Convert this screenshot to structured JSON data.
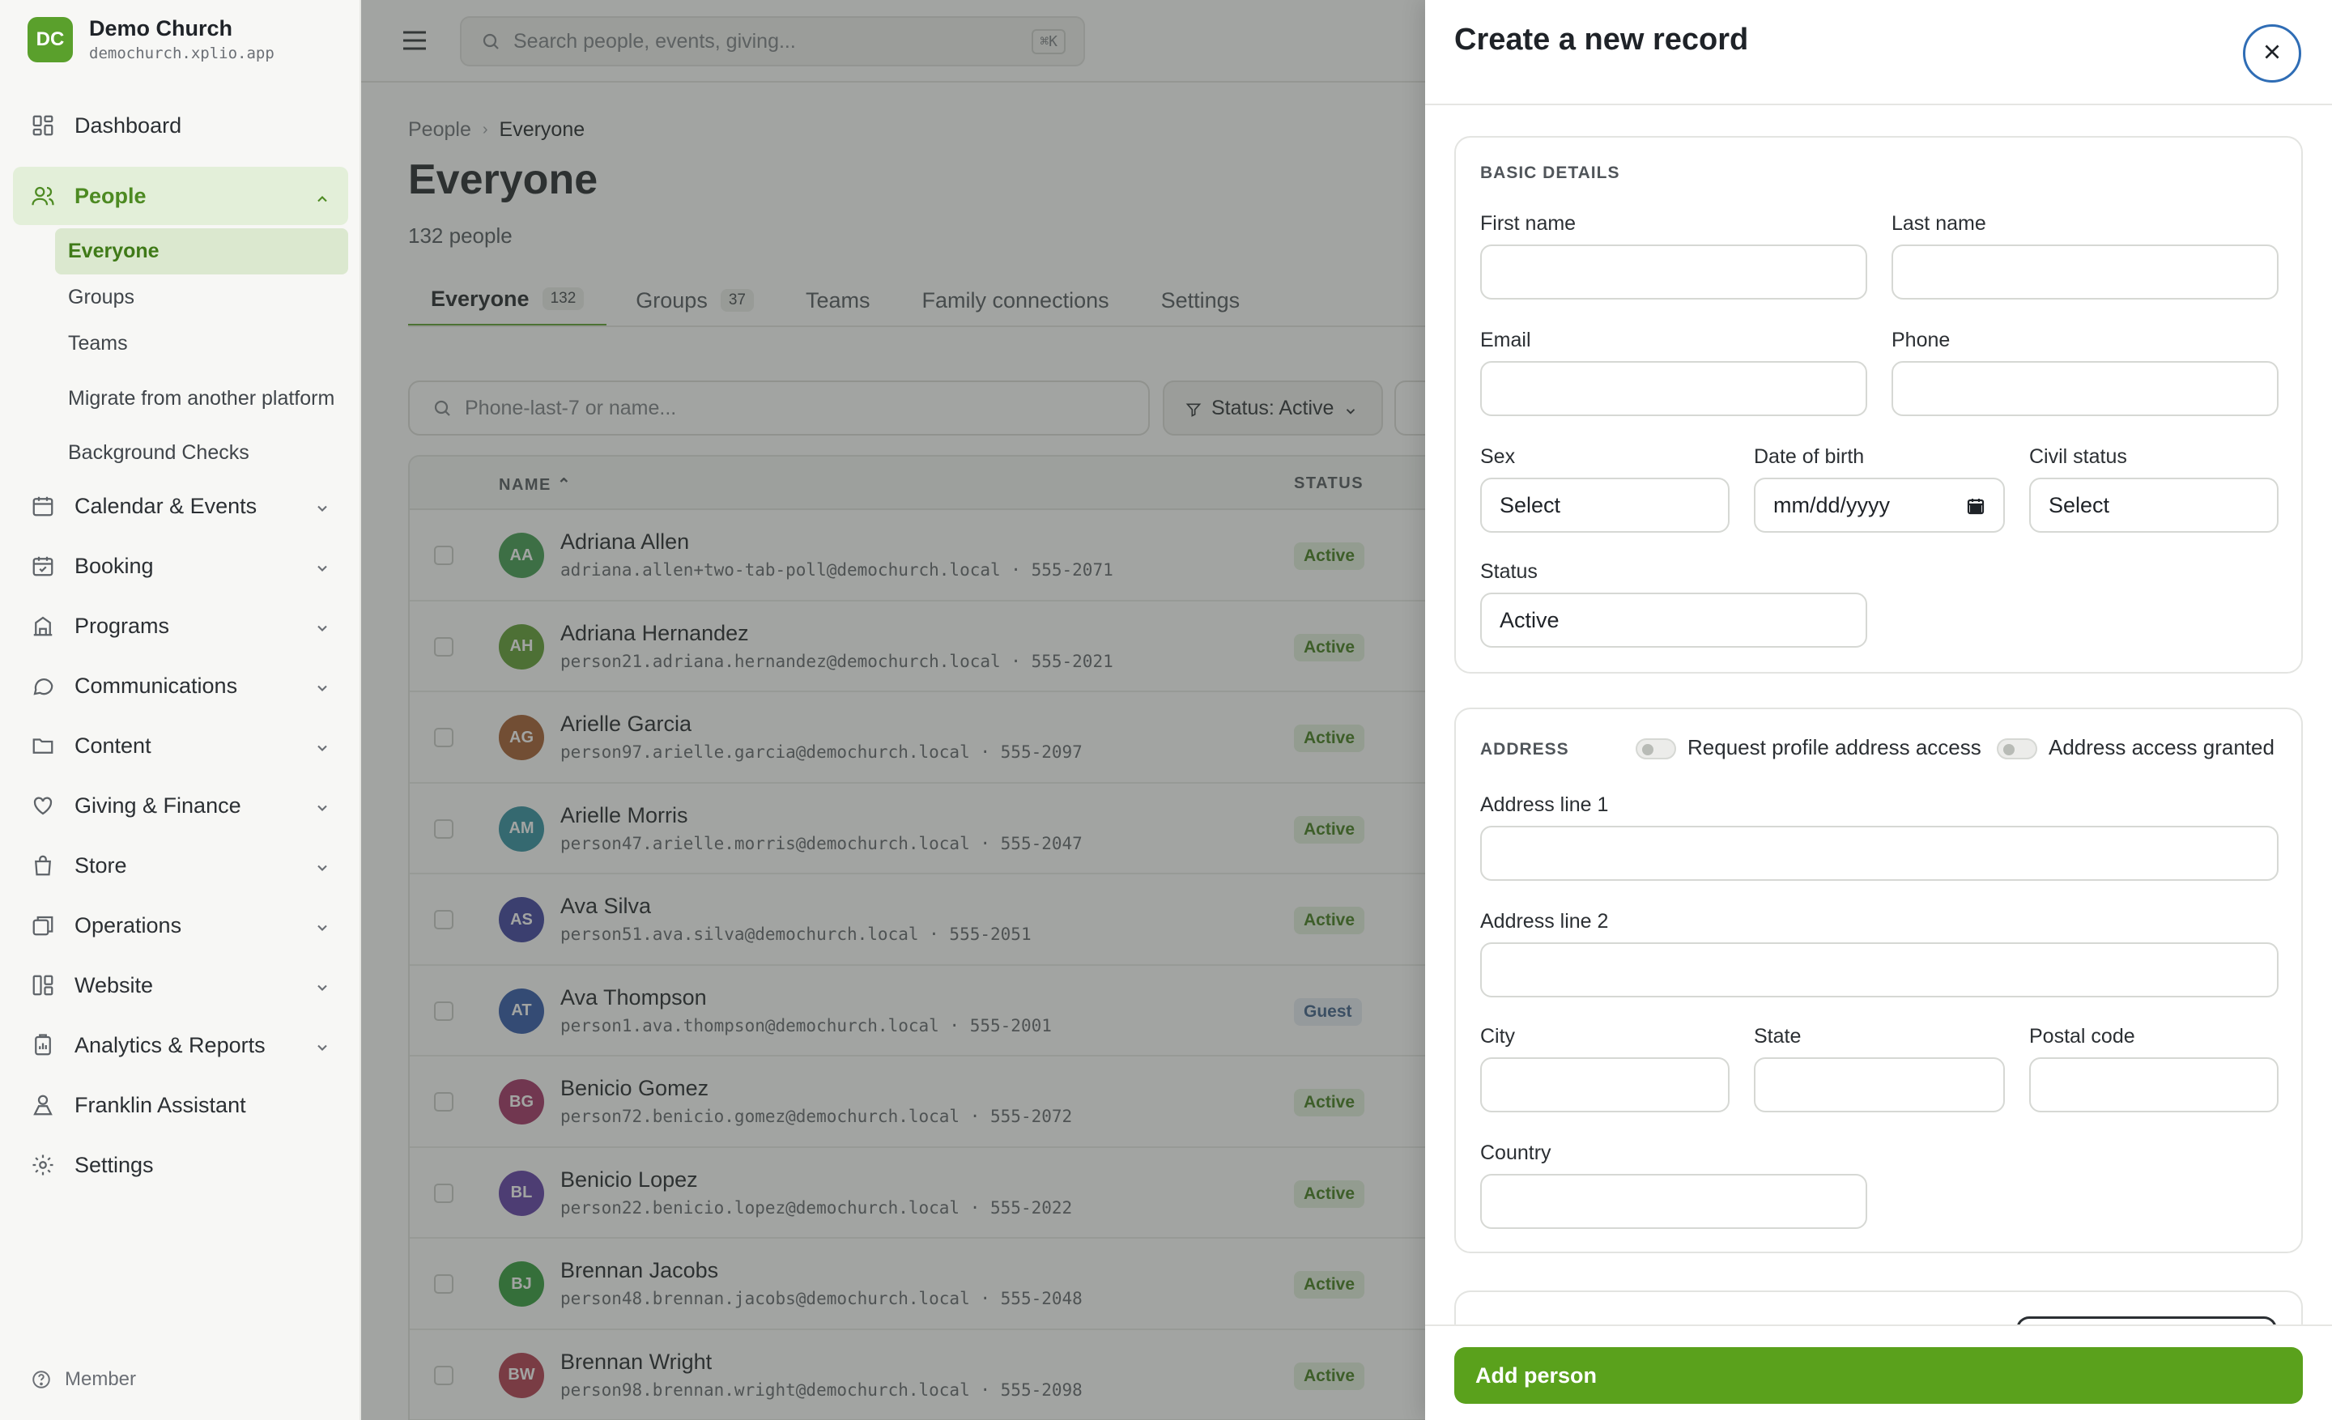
{
  "brand": {
    "initials": "DC",
    "name": "Demo Church",
    "domain": "demochurch.xplio.app"
  },
  "nav": {
    "dashboard": "Dashboard",
    "people": "People",
    "people_sub": [
      "Everyone",
      "Groups",
      "Teams",
      "Migrate from another platform",
      "Background Checks"
    ],
    "calendar": "Calendar & Events",
    "booking": "Booking",
    "programs": "Programs",
    "communications": "Communications",
    "content": "Content",
    "giving": "Giving & Finance",
    "store": "Store",
    "operations": "Operations",
    "website": "Website",
    "analytics": "Analytics & Reports",
    "assistant": "Franklin Assistant",
    "settings": "Settings"
  },
  "member": "Member",
  "search": {
    "placeholder": "Search people, events, giving...",
    "shortcut": "⌘K"
  },
  "breadcrumb": {
    "parent": "People",
    "current": "Everyone"
  },
  "page": {
    "title": "Everyone",
    "count": "132 people"
  },
  "tabs": [
    {
      "label": "Everyone",
      "badge": "132"
    },
    {
      "label": "Groups",
      "badge": "37"
    },
    {
      "label": "Teams"
    },
    {
      "label": "Family connections"
    },
    {
      "label": "Settings"
    }
  ],
  "table_search": {
    "placeholder": "Phone-last-7 or name..."
  },
  "filter": {
    "label": "Status: Active"
  },
  "table": {
    "headers": {
      "name": "NAME",
      "status": "STATUS"
    },
    "rows": [
      {
        "initials": "AA",
        "name": "Adriana Allen",
        "meta": "adriana.allen+two-tab-poll@demochurch.local · 555-2071",
        "status": "Active",
        "color": "#3f9a4e"
      },
      {
        "initials": "AH",
        "name": "Adriana Hernandez",
        "meta": "person21.adriana.hernandez@demochurch.local · 555-2021",
        "status": "Active",
        "color": "#5c9b2f"
      },
      {
        "initials": "AG",
        "name": "Arielle Garcia",
        "meta": "person97.arielle.garcia@demochurch.local · 555-2097",
        "status": "Active",
        "color": "#a45a2c"
      },
      {
        "initials": "AM",
        "name": "Arielle Morris",
        "meta": "person47.arielle.morris@demochurch.local · 555-2047",
        "status": "Active",
        "color": "#2f8fa0"
      },
      {
        "initials": "AS",
        "name": "Ava Silva",
        "meta": "person51.ava.silva@demochurch.local · 555-2051",
        "status": "Active",
        "color": "#3b3f9e"
      },
      {
        "initials": "AT",
        "name": "Ava Thompson",
        "meta": "person1.ava.thompson@demochurch.local · 555-2001",
        "status": "Guest",
        "color": "#2d55a8"
      },
      {
        "initials": "BG",
        "name": "Benicio Gomez",
        "meta": "person72.benicio.gomez@demochurch.local · 555-2072",
        "status": "Active",
        "color": "#a22f62"
      },
      {
        "initials": "BL",
        "name": "Benicio Lopez",
        "meta": "person22.benicio.lopez@demochurch.local · 555-2022",
        "status": "Active",
        "color": "#5d3aa6"
      },
      {
        "initials": "BJ",
        "name": "Brennan Jacobs",
        "meta": "person48.brennan.jacobs@demochurch.local · 555-2048",
        "status": "Active",
        "color": "#2e9a38"
      },
      {
        "initials": "BW",
        "name": "Brennan Wright",
        "meta": "person98.brennan.wright@demochurch.local · 555-2098",
        "status": "Active",
        "color": "#b0384c"
      }
    ]
  },
  "drawer": {
    "title": "Create a new record",
    "basic": {
      "title": "BASIC DETAILS",
      "first_name": "First name",
      "last_name": "Last name",
      "email": "Email",
      "phone": "Phone",
      "sex": "Sex",
      "sex_value": "Select",
      "dob": "Date of birth",
      "dob_value": "mm/dd/yyyy",
      "civil": "Civil status",
      "civil_value": "Select",
      "status": "Status",
      "status_value": "Active"
    },
    "address": {
      "title": "ADDRESS",
      "request_toggle": "Request profile address access",
      "granted_toggle": "Address access granted",
      "line1": "Address line 1",
      "line2": "Address line 2",
      "city": "City",
      "state": "State",
      "postal": "Postal code",
      "country": "Country"
    },
    "submit": "Add person"
  }
}
